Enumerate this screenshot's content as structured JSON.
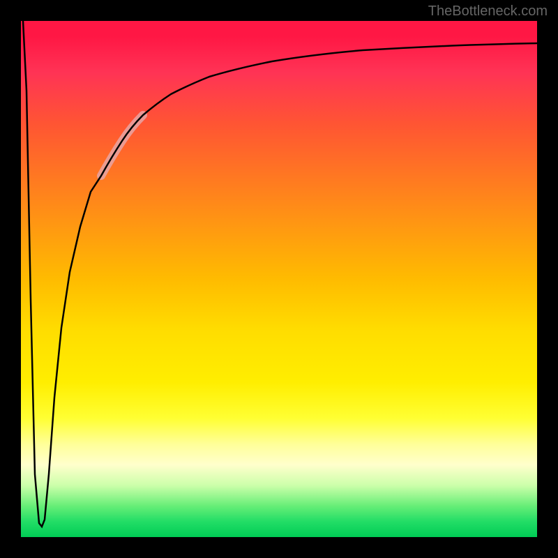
{
  "watermark": "TheBottleneck.com",
  "chart_data": {
    "type": "line",
    "title": "",
    "xlabel": "",
    "ylabel": "",
    "xlim": [
      0,
      100
    ],
    "ylim": [
      0,
      100
    ],
    "background": "rainbow-gradient-red-to-green-vertical",
    "series": [
      {
        "name": "bottleneck-curve",
        "description": "V-shaped curve: sharp drop from top-left to near-bottom, then asymptotic rise toward top-right",
        "x": [
          0,
          1,
          2,
          3,
          4,
          5,
          6,
          8,
          10,
          12,
          15,
          18,
          22,
          26,
          30,
          35,
          40,
          50,
          60,
          70,
          80,
          90,
          100
        ],
        "y": [
          100,
          50,
          10,
          2,
          3,
          15,
          30,
          45,
          55,
          62,
          70,
          75,
          80,
          83,
          85,
          87,
          89,
          91,
          92.5,
          93.5,
          94,
          94.5,
          95
        ]
      }
    ],
    "highlight": {
      "x_range": [
        15,
        22
      ],
      "description": "pink/salmon thick segment overlay on curve"
    }
  }
}
